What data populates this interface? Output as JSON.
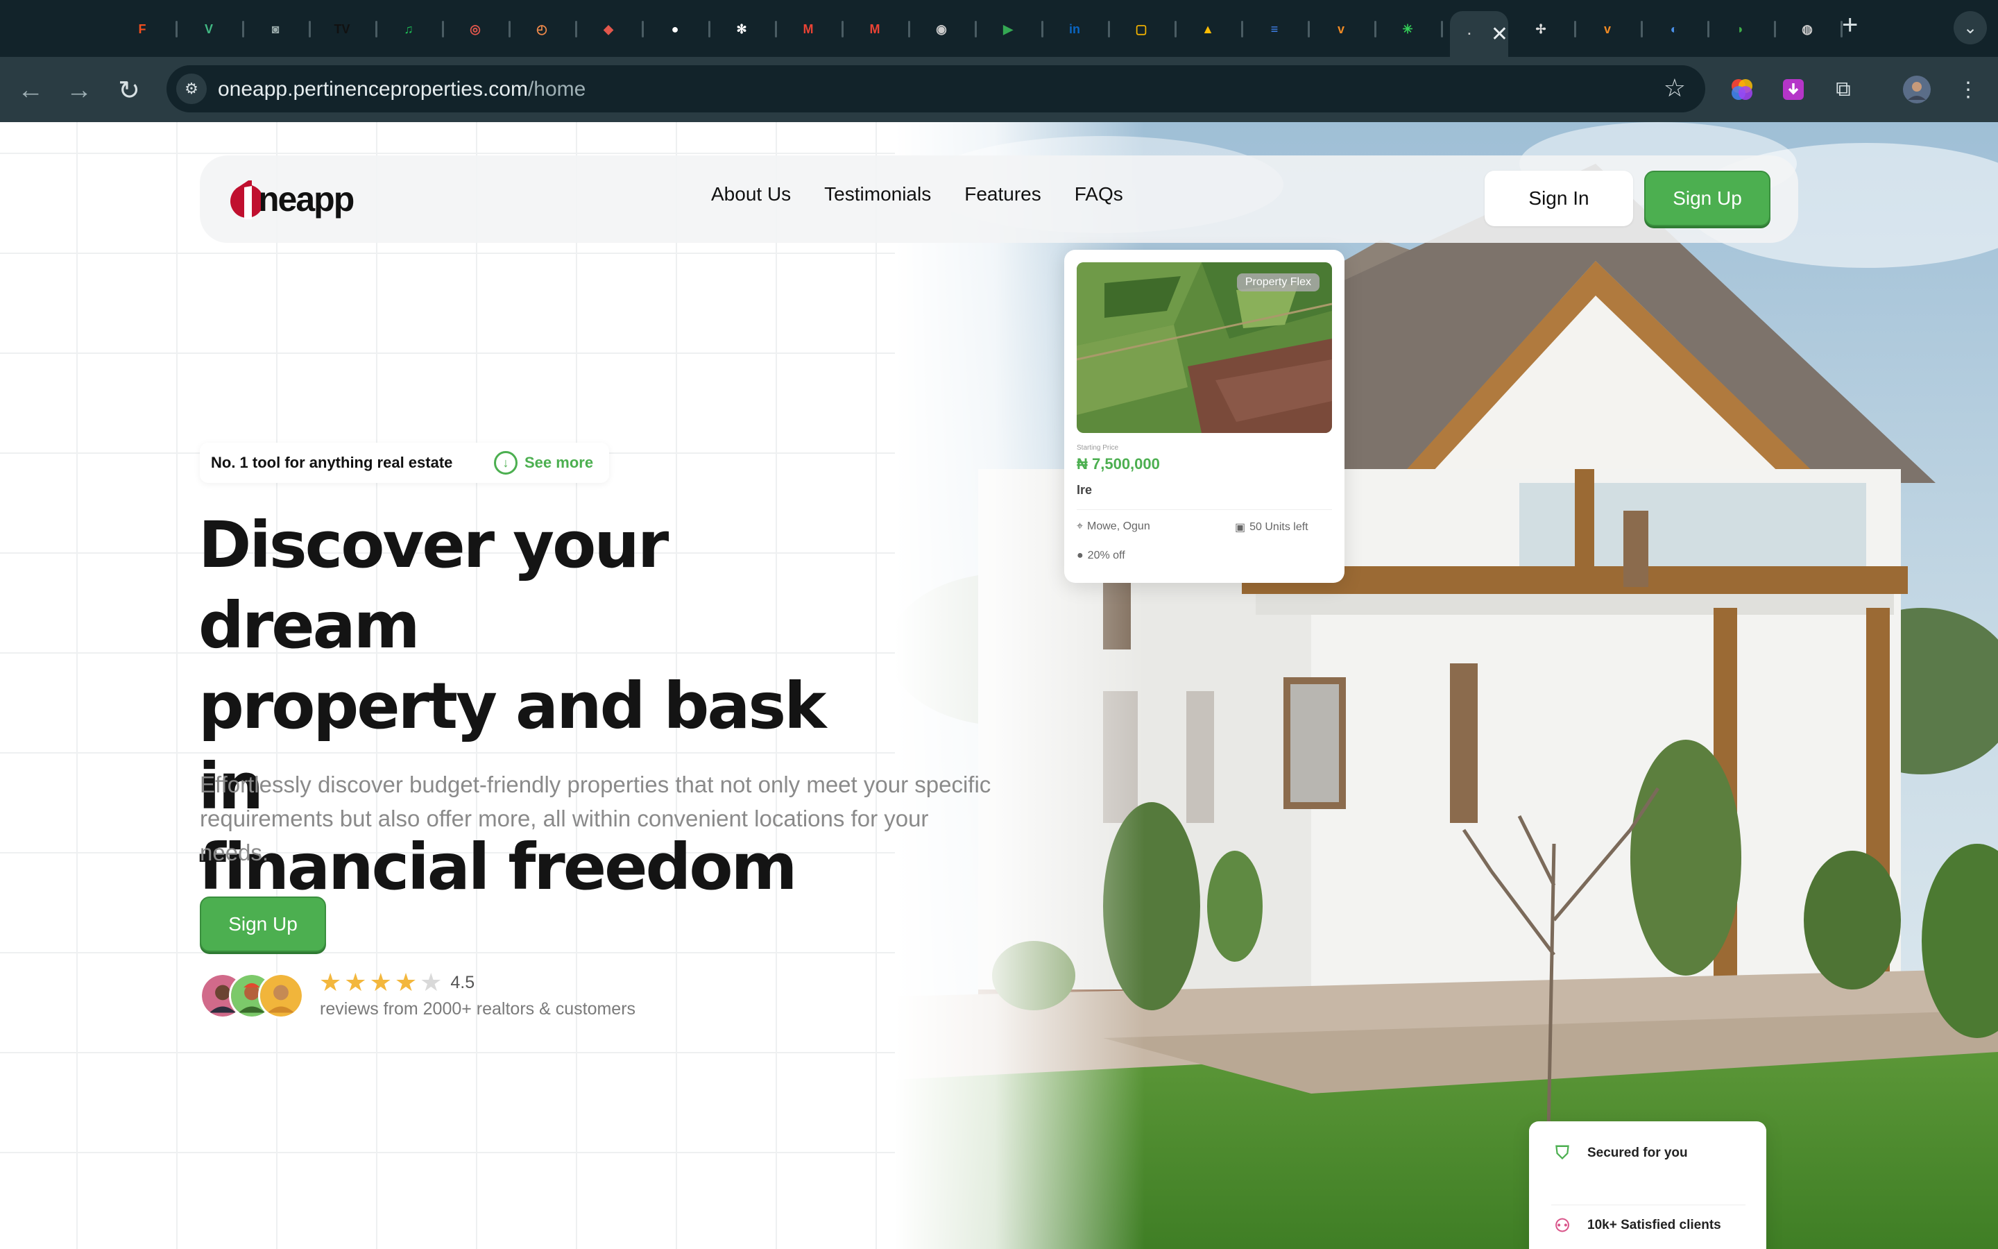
{
  "browser": {
    "url_host": "oneapp.pertinenceproperties.com",
    "url_path": "/home",
    "active_tab_close": "✕",
    "new_tab": "+",
    "tabs": [
      {
        "icon": "figma-icon",
        "glyph": "F",
        "color": "#f24e1e"
      },
      {
        "icon": "vue-icon",
        "glyph": "V",
        "color": "#41b883"
      },
      {
        "icon": "camera-icon",
        "glyph": "◙",
        "color": "#9aa"
      },
      {
        "icon": "tradingview-icon",
        "glyph": "TV",
        "color": "#111"
      },
      {
        "icon": "spotify-icon",
        "glyph": "♫",
        "color": "#1db954"
      },
      {
        "icon": "target-icon",
        "glyph": "◎",
        "color": "#e2574c"
      },
      {
        "icon": "compass-icon",
        "glyph": "◴",
        "color": "#f08a4b"
      },
      {
        "icon": "app-icon",
        "glyph": "◆",
        "color": "#e2574c"
      },
      {
        "icon": "github-icon",
        "glyph": "●",
        "color": "#fff"
      },
      {
        "icon": "openai-icon",
        "glyph": "✻",
        "color": "#fff"
      },
      {
        "icon": "gmail-icon",
        "glyph": "M",
        "color": "#ea4335"
      },
      {
        "icon": "gmail-icon",
        "glyph": "M",
        "color": "#ea4335"
      },
      {
        "icon": "chrome-icon",
        "glyph": "◉",
        "color": "#ccc"
      },
      {
        "icon": "meet-icon",
        "glyph": "▶",
        "color": "#34a853"
      },
      {
        "icon": "linkedin-icon",
        "glyph": "in",
        "color": "#0a66c2"
      },
      {
        "icon": "chat-icon",
        "glyph": "▢",
        "color": "#f5b400"
      },
      {
        "icon": "drive-icon",
        "glyph": "▲",
        "color": "#fbbc04"
      },
      {
        "icon": "docs-icon",
        "glyph": "≡",
        "color": "#4285f4"
      },
      {
        "icon": "v-brand-icon",
        "glyph": "v",
        "color": "#f08a24"
      },
      {
        "icon": "asterisk-icon",
        "glyph": "✳",
        "color": "#34d058"
      },
      {
        "icon": "active-tab",
        "glyph": "·",
        "color": "#ccc"
      },
      {
        "icon": "pinwheel-icon",
        "glyph": "✢",
        "color": "#ddd"
      },
      {
        "icon": "v-brand-icon",
        "glyph": "v",
        "color": "#f08a24"
      },
      {
        "icon": "globe-blue-icon",
        "glyph": "◐",
        "color": "#4a8fe7"
      },
      {
        "icon": "leaf-icon",
        "glyph": "◗",
        "color": "#3fae49"
      },
      {
        "icon": "globe-icon",
        "glyph": "◍",
        "color": "#ccc"
      }
    ]
  },
  "nav": {
    "logo_text": "neapp",
    "links": [
      "About Us",
      "Testimonials",
      "Features",
      "FAQs"
    ],
    "sign_in": "Sign In",
    "sign_up": "Sign Up"
  },
  "hero": {
    "badge_text": "No. 1 tool for anything real estate",
    "badge_link": "See more",
    "headline": [
      "Discover your dream",
      "property and bask in",
      "financial freedom"
    ],
    "subtext": "Effortlessly discover budget-friendly properties that not only meet your specific requirements but also offer more, all within convenient locations for your needs.",
    "cta": "Sign Up",
    "rating": {
      "value": 4.5,
      "max": 5,
      "display": "4.5"
    },
    "reviews": "reviews from 2000+ realtors & customers"
  },
  "property_card": {
    "tag": "Property Flex",
    "price_label": "Starting Price",
    "price": "₦ 7,500,000",
    "name": "Ire",
    "location": "Mowe, Ogun",
    "units": "50 Units left",
    "discount": "20% off"
  },
  "stats_card": {
    "secured": "Secured for you",
    "clients": "10k+ Satisfied clients"
  },
  "colors": {
    "brand_green": "#4caf50",
    "brand_red": "#c0102f",
    "chrome_dark": "#12232a",
    "chrome_toolbar": "#2a3c43"
  }
}
